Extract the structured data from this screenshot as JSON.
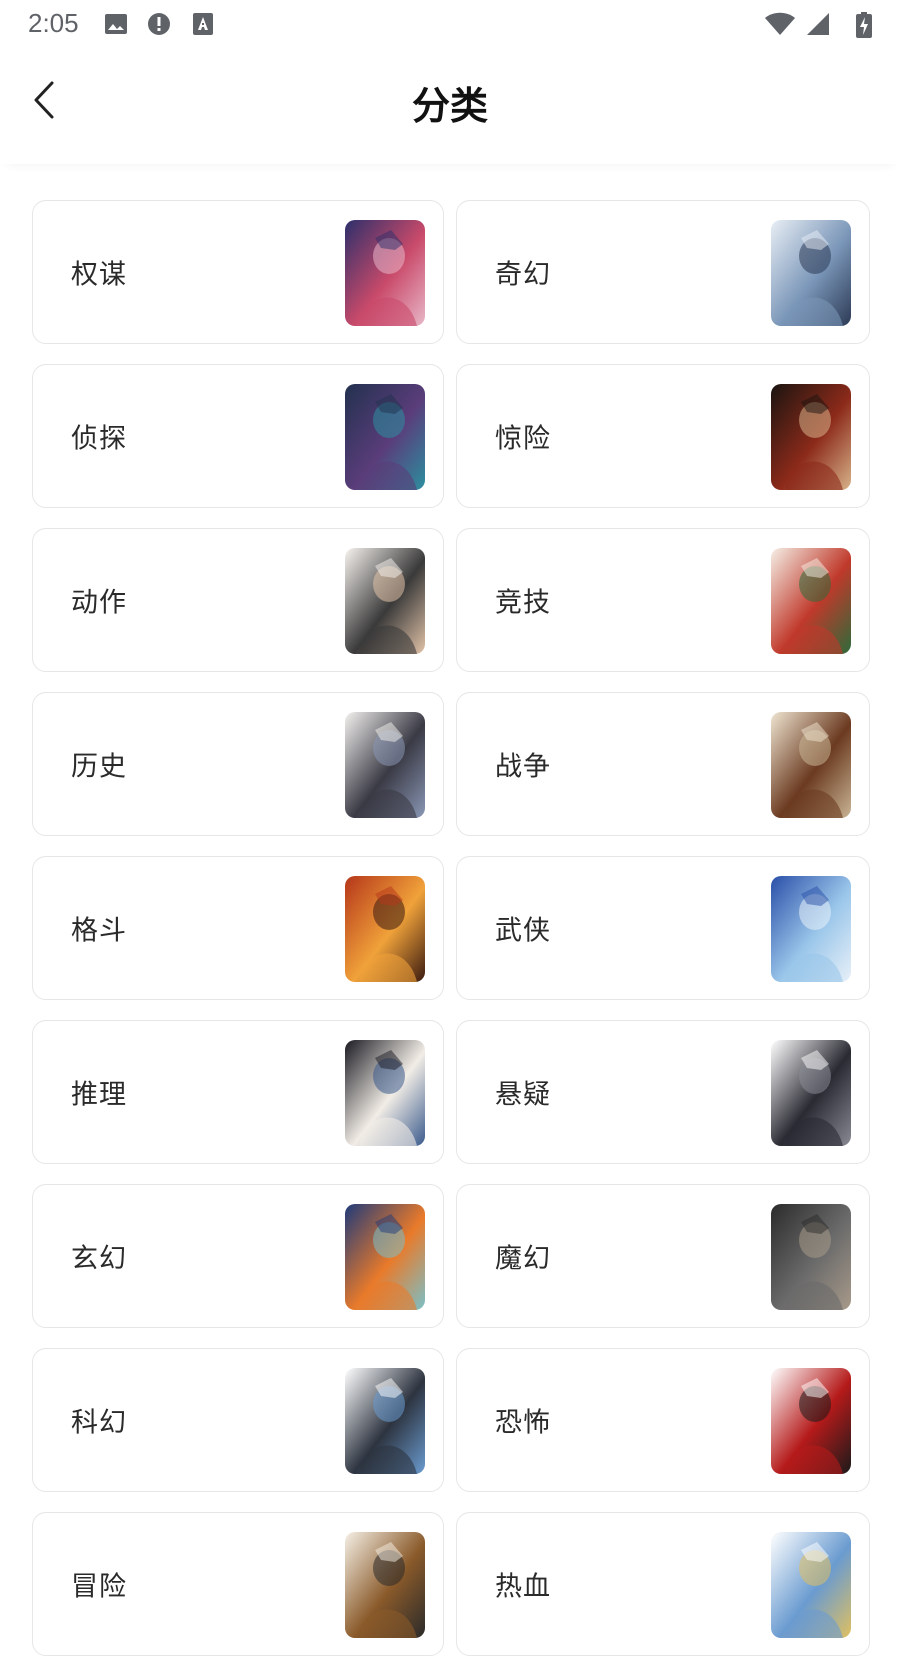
{
  "status_bar": {
    "time": "2:05",
    "left_icons": [
      "image-icon",
      "alert-icon",
      "font-download-icon"
    ],
    "right_icons": [
      "wifi-icon",
      "signal-icon",
      "battery-charging-icon"
    ]
  },
  "header": {
    "title": "分类",
    "back_icon": "back-arrow-icon"
  },
  "categories": [
    {
      "label": "权谋",
      "thumb_colors": [
        "#2d2f6b",
        "#c94a6a",
        "#e8b7c8"
      ]
    },
    {
      "label": "奇幻",
      "thumb_colors": [
        "#e8eef5",
        "#7a96b8",
        "#2c3a55"
      ]
    },
    {
      "label": "侦探",
      "thumb_colors": [
        "#22314f",
        "#5a3d7a",
        "#2c8fa0"
      ]
    },
    {
      "label": "惊险",
      "thumb_colors": [
        "#1a1410",
        "#8c2a1a",
        "#d7b38a"
      ]
    },
    {
      "label": "动作",
      "thumb_colors": [
        "#f7f3ef",
        "#3a3a3a",
        "#e2c3a8"
      ]
    },
    {
      "label": "竞技",
      "thumb_colors": [
        "#f5efe6",
        "#c0392b",
        "#2d6b3a"
      ]
    },
    {
      "label": "历史",
      "thumb_colors": [
        "#f3f1ee",
        "#3a3a45",
        "#8a97b5"
      ]
    },
    {
      "label": "战争",
      "thumb_colors": [
        "#efe5d2",
        "#6b3a20",
        "#c9b594"
      ]
    },
    {
      "label": "格斗",
      "thumb_colors": [
        "#b5361a",
        "#f0a23a",
        "#3a1a10"
      ]
    },
    {
      "label": "武侠",
      "thumb_colors": [
        "#2a4fa8",
        "#9ac6ea",
        "#e8f0f8"
      ]
    },
    {
      "label": "推理",
      "thumb_colors": [
        "#1a1a22",
        "#f2ede6",
        "#3a5a8c"
      ]
    },
    {
      "label": "悬疑",
      "thumb_colors": [
        "#ffffff",
        "#2a2a33",
        "#8a8a95"
      ]
    },
    {
      "label": "玄幻",
      "thumb_colors": [
        "#1f3a7a",
        "#e97a2a",
        "#7ac0c8"
      ]
    },
    {
      "label": "魔幻",
      "thumb_colors": [
        "#2b2b2b",
        "#6b6b6b",
        "#a89a8a"
      ]
    },
    {
      "label": "科幻",
      "thumb_colors": [
        "#ffffff",
        "#2d3440",
        "#6a9bd0"
      ]
    },
    {
      "label": "恐怖",
      "thumb_colors": [
        "#ffffff",
        "#b51a1a",
        "#1a1a1a"
      ]
    },
    {
      "label": "冒险",
      "thumb_colors": [
        "#f5f0e6",
        "#8a5a2a",
        "#2a2a2a"
      ]
    },
    {
      "label": "热血",
      "thumb_colors": [
        "#ffffff",
        "#6a9bd0",
        "#e0c060"
      ]
    }
  ]
}
